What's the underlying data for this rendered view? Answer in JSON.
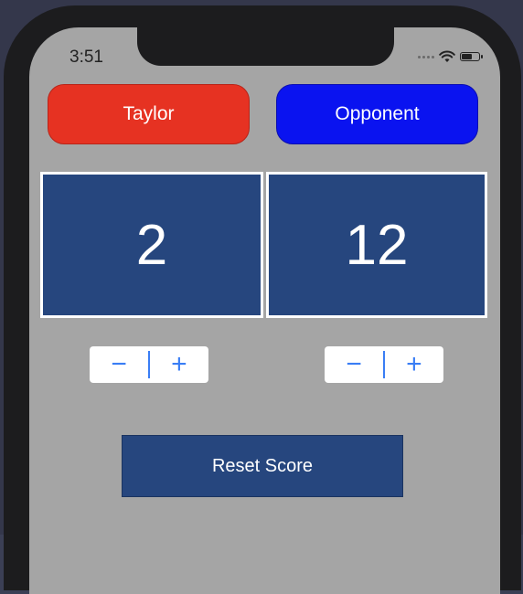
{
  "status_bar": {
    "time": "3:51",
    "icons": [
      "signal-dots-icon",
      "wifi-icon",
      "battery-icon"
    ],
    "battery_level": 0.55
  },
  "players": {
    "left": {
      "name": "Taylor",
      "color": "#e63222"
    },
    "right": {
      "name": "Opponent",
      "color": "#0a13f0"
    }
  },
  "scores": {
    "left": "2",
    "right": "12"
  },
  "steppers": {
    "decrement_label": "−",
    "increment_label": "+"
  },
  "reset_button": {
    "label": "Reset Score"
  },
  "colors": {
    "score_background": "#26467e",
    "screen_background": "#a5a5a5",
    "stepper_tint": "#3a7ef5"
  }
}
